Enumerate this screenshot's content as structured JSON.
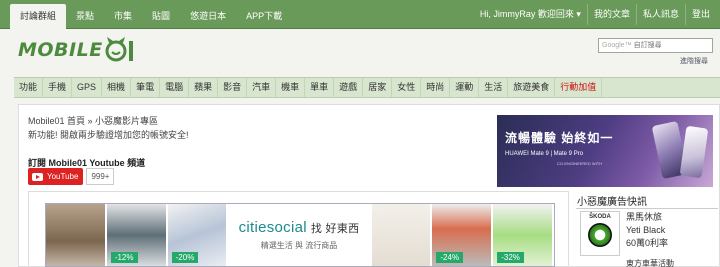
{
  "topnav": {
    "items": [
      "討論群組",
      "景點",
      "市集",
      "貼圖",
      "悠遊日本",
      "APP下載"
    ]
  },
  "user": {
    "greeting": "Hi, JimmyRay 歡迎回來",
    "my_articles": "我的文章",
    "private_messages": "私人訊息",
    "logout": "登出"
  },
  "logo": {
    "text": "MOBILE"
  },
  "search": {
    "placeholder": "自訂搜尋",
    "google_label": "Google™",
    "advanced": "進階搜尋"
  },
  "categories": [
    "功能",
    "手機",
    "GPS",
    "相機",
    "筆電",
    "電腦",
    "蘋果",
    "影音",
    "汽車",
    "機車",
    "單車",
    "遊戲",
    "居家",
    "女性",
    "時尚",
    "運動",
    "生活",
    "旅遊美食",
    "行動加值"
  ],
  "breadcrumb": "Mobile01 首頁 » 小惡魔影片專區",
  "notice": "新功能! 閱啟兩步驗證增加您的帳號安全!",
  "subscribe": {
    "title": "訂閱 Mobile01 Youtube 頻道",
    "button": "YouTube",
    "count": "999+"
  },
  "banner": {
    "headline": "流暢體驗 始終如一",
    "models": "HUAWEI Mate 9 | Mate 9 Pro",
    "small": "CO-ENGINEERED WITH"
  },
  "ad": {
    "brand": "citiesocial",
    "brand_sub": "找 好東西",
    "tagline": "精選生活 與 流行商品",
    "discounts": [
      "-12%",
      "-20%",
      "-24%",
      "-32%"
    ]
  },
  "sidebar": {
    "title": "小惡魔廣告快訊",
    "skoda_label": "ŠKODA",
    "item_lines": [
      "黑馬休旅",
      "Yeti Black",
      "60萬0利率"
    ],
    "next_item": "東方車華活動"
  },
  "colors": {
    "topbar": "#6a9a5a",
    "accent": "#4c8a3e",
    "youtube": "#d22",
    "discount": "#25a96b"
  }
}
